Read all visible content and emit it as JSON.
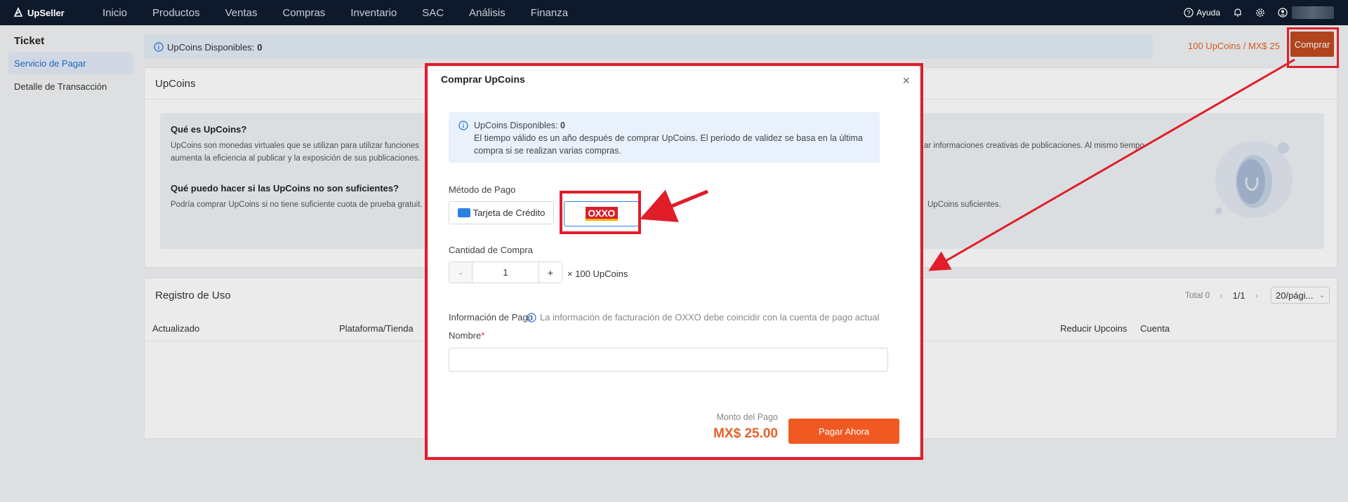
{
  "app": {
    "logo_text": "UpSeller"
  },
  "nav": {
    "items": [
      "Inicio",
      "Productos",
      "Ventas",
      "Compras",
      "Inventario",
      "SAC",
      "Análisis",
      "Finanza"
    ],
    "help": "Ayuda"
  },
  "sidebar": {
    "title": "Ticket",
    "items": [
      {
        "label": "Servicio de Pagar",
        "active": true
      },
      {
        "label": "Detalle de Transacción",
        "active": false
      }
    ]
  },
  "balance_bar": {
    "label": "UpCoins Disponibles:",
    "value": "0"
  },
  "rate_text": "100 UpCoins / MX$ 25",
  "buy_button": "Comprar",
  "upcoins_card": {
    "title": "UpCoins",
    "q1": "Qué es UpCoins?",
    "a1_left": "UpCoins son monedas virtuales que se utilizan para utilizar funciones",
    "a1_left2": "aumenta la eficiencia al publicar y la exposición de sus publicaciones.",
    "a1_right": "ar informaciones creativas de publicaciones. Al mismo tiempo",
    "q2": "Qué puedo hacer si las UpCoins no son suficientes?",
    "a2_left": "Podría comprar UpCoins si no tiene suficiente cuota de prueba gratuit.",
    "a2_right": "UpCoins suficientes."
  },
  "usage_card": {
    "title": "Registro de Uso",
    "total": "Total 0",
    "page": "1/1",
    "page_size": "20/pági...",
    "columns": {
      "updated": "Actualizado",
      "platform": "Plataforma/Tienda",
      "reduce": "Reducir Upcoins",
      "account": "Cuenta"
    }
  },
  "modal": {
    "title": "Comprar UpCoins",
    "notice_label": "UpCoins Disponibles:",
    "notice_value": "0",
    "notice_text": "El tiempo válido es un año después de comprar UpCoins. El período de validez se basa en la última compra si se realizan varias compras.",
    "payment_method_label": "Método de Pago",
    "card_option": "Tarjeta de Crédito",
    "oxxo_option": "OXXO",
    "quantity_label": "Cantidad de Compra",
    "quantity_minus": "-",
    "quantity_value": "1",
    "quantity_plus": "+",
    "quantity_unit": "× 100 UpCoins",
    "payment_info_label": "Información de Pago",
    "payment_info_hint": "La información de facturación de OXXO debe coincidir con la cuenta de pago actual",
    "name_label": "Nombre",
    "required_mark": "*",
    "amount_label": "Monto del Pago",
    "amount_value": "MX$ 25.00",
    "pay_button": "Pagar Ahora"
  },
  "colors": {
    "accent": "#f05a22",
    "annotation": "#e11d2a",
    "nav_bg": "#0e1a2b",
    "link_blue": "#1f6fd0"
  }
}
